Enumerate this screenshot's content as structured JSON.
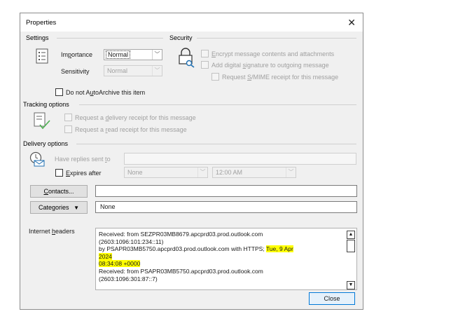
{
  "window": {
    "title": "Properties",
    "close_glyph": "✕"
  },
  "settings": {
    "heading": "Settings",
    "importance_label_pre": "Im",
    "importance_label_accel": "p",
    "importance_label_post": "ortance",
    "importance_value": "Normal",
    "sensitivity_label": "Sensitivity",
    "sensitivity_value": "Normal",
    "autoarchive_pre": "Do not A",
    "autoarchive_accel": "u",
    "autoarchive_post": "toArchive this item",
    "autoarchive_checked": false
  },
  "security": {
    "heading": "Security",
    "encrypt_accel": "E",
    "encrypt_post": "ncrypt message contents and attachments",
    "signature_pre": "Add digital ",
    "signature_accel": "s",
    "signature_post": "ignature to outgoing message",
    "smime_pre": "Request ",
    "smime_accel": "S",
    "smime_post": "/MIME receipt for this message"
  },
  "tracking": {
    "heading": "Tracking options",
    "delivery_pre": "Request a ",
    "delivery_accel": "d",
    "delivery_post": "elivery receipt for this message",
    "read_pre": "Request a ",
    "read_accel": "r",
    "read_post": "ead receipt for this message"
  },
  "delivery": {
    "heading": "Delivery options",
    "replies_pre": "Have replies sent ",
    "replies_accel": "t",
    "replies_post": "o",
    "expires_accel": "E",
    "expires_post": "xpires after",
    "expires_date": "None",
    "expires_time": "12:00 AM"
  },
  "contacts": {
    "pre": "",
    "accel": "C",
    "post": "ontacts...",
    "value": ""
  },
  "categories": {
    "pre": "Cate",
    "accel": "g",
    "post": "ories",
    "arrow": "▼",
    "value": "None"
  },
  "headers": {
    "label_pre": "Internet ",
    "label_accel": "h",
    "label_post": "eaders",
    "line1": "Received: from SEZPR03MB8679.apcprd03.prod.outlook.com",
    "line2": "(2603:1096:101:234::11)",
    "line3_pre": " by PSAPR03MB5750.apcprd03.prod.outlook.com with HTTPS; ",
    "line3_hl": "Tue, 9 Apr",
    "line4_hl": "2024",
    "line5_hl": " 08:34:08 +0000",
    "line6": "Received: from PSAPR03MB5750.apcprd03.prod.outlook.com",
    "line7": "(2603:1096:301:87::7)"
  },
  "buttons": {
    "close": "Close"
  },
  "icons": [
    "list-icon",
    "padlock-key-icon",
    "tracking-checklist-icon",
    "clock-envelope-icon",
    "dropdown-arrow-icon",
    "scroll-up-icon",
    "scroll-down-icon"
  ]
}
